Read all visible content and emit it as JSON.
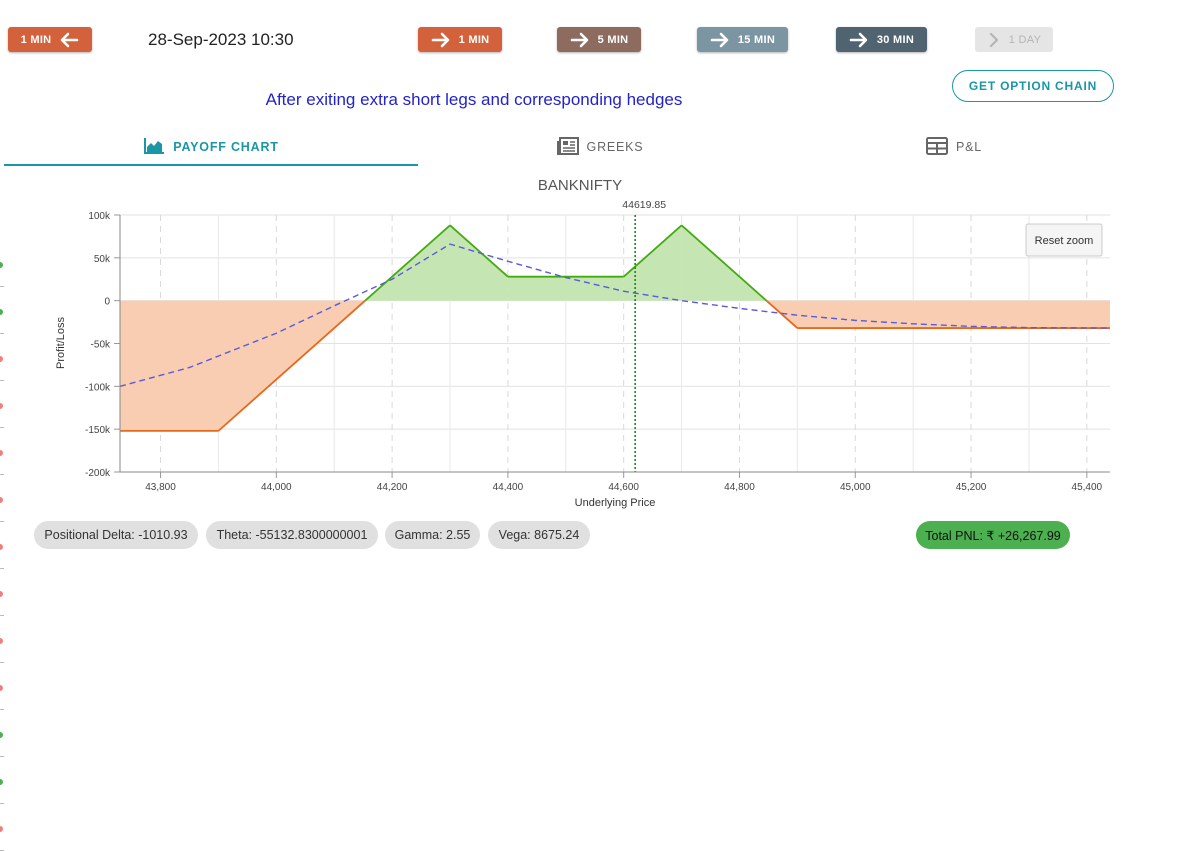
{
  "toolbar": {
    "back_label": "1 MIN",
    "datetime": "28-Sep-2023 10:30",
    "forward_buttons": [
      {
        "label": "1 MIN",
        "color": "#d3623c"
      },
      {
        "label": "5 MIN",
        "color": "#8d6b5e"
      },
      {
        "label": "15 MIN",
        "color": "#7b95a3"
      },
      {
        "label": "30 MIN",
        "color": "#4f6470"
      },
      {
        "label": "1 DAY",
        "color": "#e5e5e5"
      }
    ],
    "back_color": "#d3623c"
  },
  "option_chain_button": "GET OPTION CHAIN",
  "subtitle": "After exiting extra short legs and corresponding hedges",
  "tabs": [
    {
      "label": "PAYOFF CHART",
      "icon": "area-chart-icon",
      "active": true
    },
    {
      "label": "GREEKS",
      "icon": "newspaper-icon",
      "active": false
    },
    {
      "label": "P&L",
      "icon": "table-grid-icon",
      "active": false
    }
  ],
  "reset_zoom_label": "Reset zoom",
  "chart_data": {
    "type": "line",
    "title": "BANKNIFTY",
    "xlabel": "Underlying Price",
    "ylabel": "Profit/Loss",
    "xlim": [
      43730,
      45440
    ],
    "ylim": [
      -200000,
      100000
    ],
    "x_ticks": [
      43800,
      44000,
      44200,
      44400,
      44600,
      44800,
      45000,
      45200,
      45400
    ],
    "x_tick_labels": [
      "43,800",
      "44,000",
      "44,200",
      "44,400",
      "44,600",
      "44,800",
      "45,000",
      "45,200",
      "45,400"
    ],
    "y_ticks": [
      100000,
      50000,
      0,
      -50000,
      -100000,
      -150000,
      -200000
    ],
    "y_tick_labels": [
      "100k",
      "50k",
      "0",
      "-50k",
      "-100k",
      "-150k",
      "-200k"
    ],
    "spot": {
      "value": 44619.85,
      "label": "44619.85",
      "color": "#1a8a1a"
    },
    "grid": true,
    "series": [
      {
        "style": "expiry",
        "x": [
          43730,
          43900,
          44300,
          44400,
          44600,
          44700,
          44900,
          45440
        ],
        "y": [
          -152000,
          -152000,
          88000,
          28000,
          28000,
          88000,
          -32000,
          -32000
        ],
        "profit_color": "#44aa11",
        "loss_color": "#e8681a",
        "profit_fill": "#c5e6b3",
        "loss_fill": "#f8cdb1"
      },
      {
        "style": "target",
        "color": "#5a5adb",
        "x": [
          43730,
          43850,
          44000,
          44100,
          44200,
          44300,
          44400,
          44500,
          44600,
          44700,
          44800,
          44900,
          45000,
          45100,
          45200,
          45300,
          45440
        ],
        "y": [
          -100000,
          -78000,
          -38000,
          -6000,
          25000,
          66000,
          46000,
          27000,
          11000,
          0,
          -9000,
          -17000,
          -23000,
          -27000,
          -30000,
          -31500,
          -32000
        ]
      }
    ]
  },
  "greeks": {
    "delta": "Positional Delta: -1010.93",
    "theta": "Theta: -55132.8300000001",
    "gamma": "Gamma: 2.55",
    "vega": "Vega: 8675.24",
    "pnl": "Total PNL: ₹ +26,267.99"
  },
  "side_dots": [
    "#4caf50",
    "#4caf50",
    "#ef7f7f",
    "#ef7f7f",
    "#ef7f7f",
    "#ef7f7f",
    "#ef7f7f",
    "#ef7f7f",
    "#ef7f7f",
    "#ef7f7f",
    "#4caf50",
    "#4caf50",
    "#ef7f7f"
  ]
}
